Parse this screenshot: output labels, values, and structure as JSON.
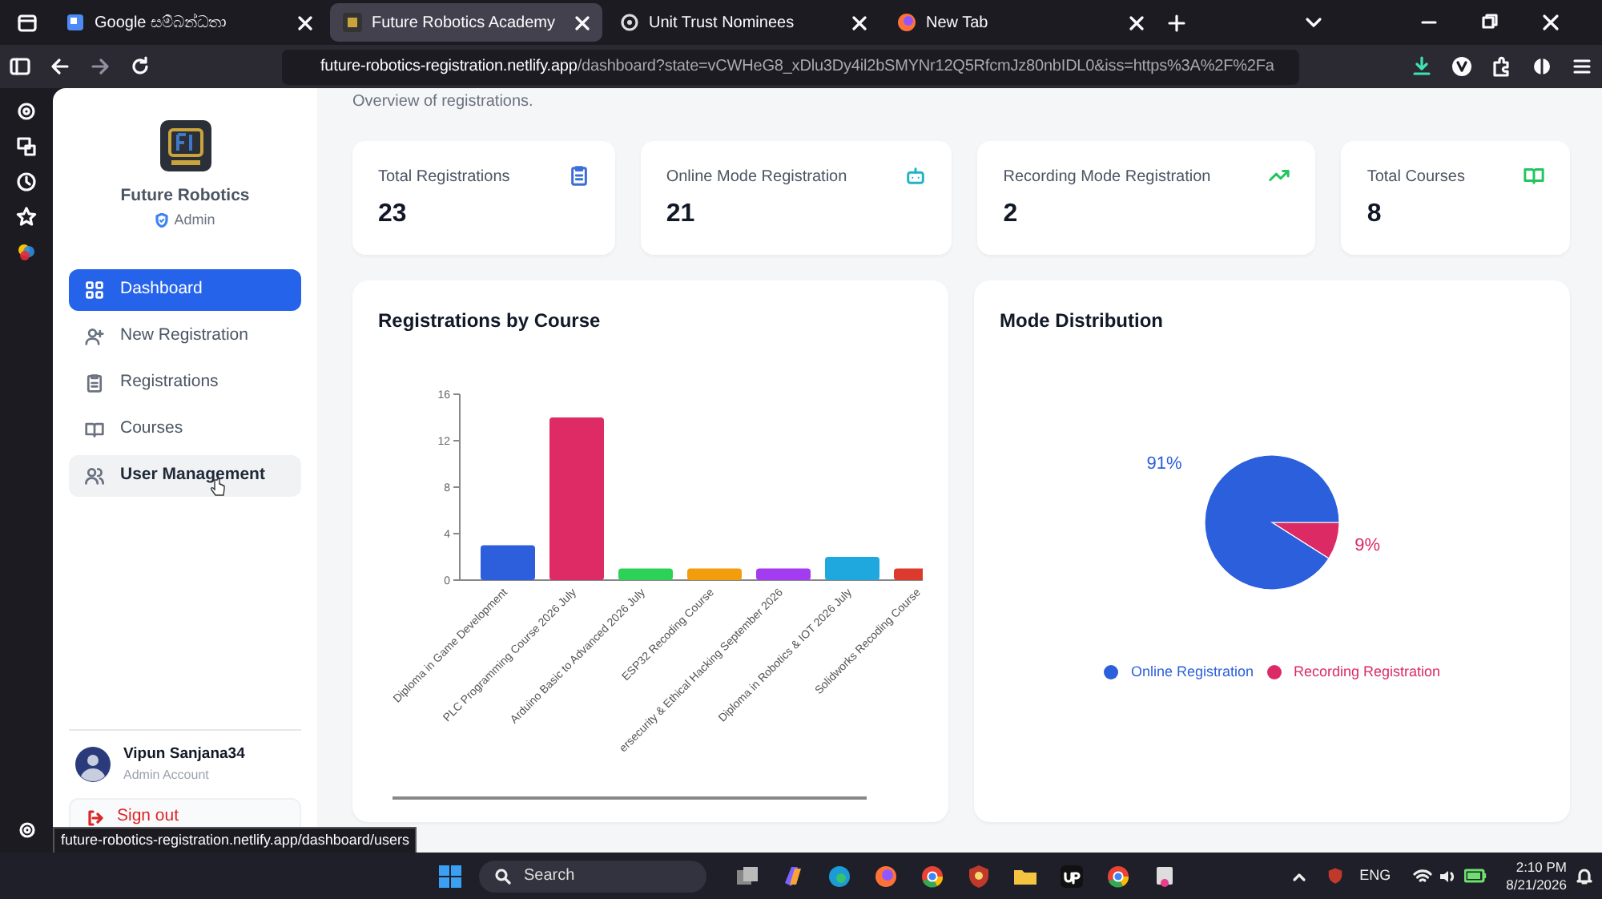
{
  "browser": {
    "tabs": [
      {
        "title": "Google සම්බන්ධතා",
        "selected": false
      },
      {
        "title": "Future Robotics Academy",
        "selected": true
      },
      {
        "title": "Unit Trust Nominees",
        "selected": false
      },
      {
        "title": "New Tab",
        "selected": false
      }
    ],
    "address": {
      "host": "future-robotics-registration.netlify.app",
      "path": "/dashboard?state=vCWHeG8_xDlu3Dy4il2bSMYNr12Q5RfcmJz80nbIDL0&iss=https%3A%2F%2Fa"
    },
    "status_link": "future-robotics-registration.netlify.app/dashboard/users"
  },
  "sidebar": {
    "brand": "Future Robotics",
    "role": "Admin",
    "items": [
      {
        "label": "Dashboard",
        "selected": true,
        "hovered": false
      },
      {
        "label": "New Registration",
        "selected": false,
        "hovered": false
      },
      {
        "label": "Registrations",
        "selected": false,
        "hovered": false
      },
      {
        "label": "Courses",
        "selected": false,
        "hovered": false
      },
      {
        "label": "User Management",
        "selected": false,
        "hovered": true
      }
    ],
    "user": {
      "name": "Vipun Sanjana34",
      "role": "Admin Account"
    },
    "sign_out": "Sign out"
  },
  "page": {
    "subtitle": "Overview of registrations."
  },
  "stats": [
    {
      "label": "Total Registrations",
      "value": "23",
      "color": "#3b6fd6"
    },
    {
      "label": "Online Mode Registration",
      "value": "21",
      "color": "#1fb3c8"
    },
    {
      "label": "Recording Mode Registration",
      "value": "2",
      "color": "#22c55e"
    },
    {
      "label": "Total Courses",
      "value": "8",
      "color": "#22c55e"
    }
  ],
  "bar_card": {
    "title": "Registrations by Course",
    "chart_data": {
      "type": "bar",
      "categories": [
        "Diploma in Game Development",
        "PLC Programming Course 2026 July",
        "Arduino Basic to Advanced 2026 July",
        "ESP32 Recoding Course",
        "ersecurity & Ethical Hacking September 2026",
        "Diploma in Robotics & IOT 2026 July",
        "Solidworks Recoding Course"
      ],
      "series": [
        {
          "values": [
            3,
            14,
            1,
            1,
            1,
            2,
            1
          ]
        }
      ],
      "colors": [
        "#2d5fdc",
        "#de2b66",
        "#2ed158",
        "#f29d0c",
        "#a33cf0",
        "#1ea8dd",
        "#dc3a2c"
      ],
      "ylim": [
        0,
        16
      ],
      "yticks": [
        0,
        4,
        8,
        12,
        16
      ]
    }
  },
  "pie_card": {
    "title": "Mode Distribution",
    "chart_data": {
      "type": "pie",
      "categories": [
        "Online Registration",
        "Recording Registration"
      ],
      "series": [
        {
          "values": [
            91,
            9
          ]
        }
      ],
      "colors": [
        "#2c5fdc",
        "#dc2a64"
      ],
      "value_labels": [
        "91%",
        "9%"
      ],
      "legend": "bottom"
    }
  },
  "taskbar": {
    "search": "Search",
    "language": "ENG",
    "time": "2:10 PM",
    "date": "8/21/2026"
  }
}
